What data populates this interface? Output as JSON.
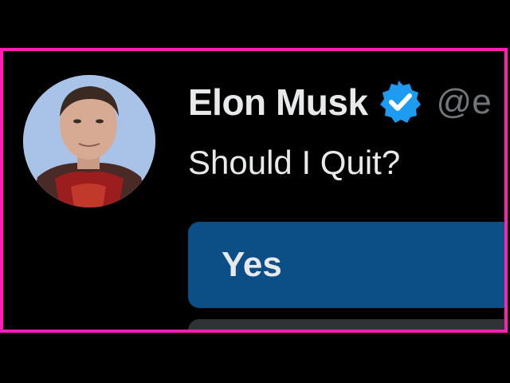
{
  "tweet": {
    "author": {
      "display_name": "Elon Musk",
      "handle": "@e",
      "verified_icon": "verified-badge-icon",
      "verified_color": "#1d9bf0"
    },
    "text": "Should I Quit?"
  },
  "poll": {
    "options": [
      {
        "label": "Yes"
      },
      {
        "label": ""
      }
    ],
    "option_color": "#0b4f86"
  },
  "frame": {
    "border_color": "#ff1fb4"
  }
}
